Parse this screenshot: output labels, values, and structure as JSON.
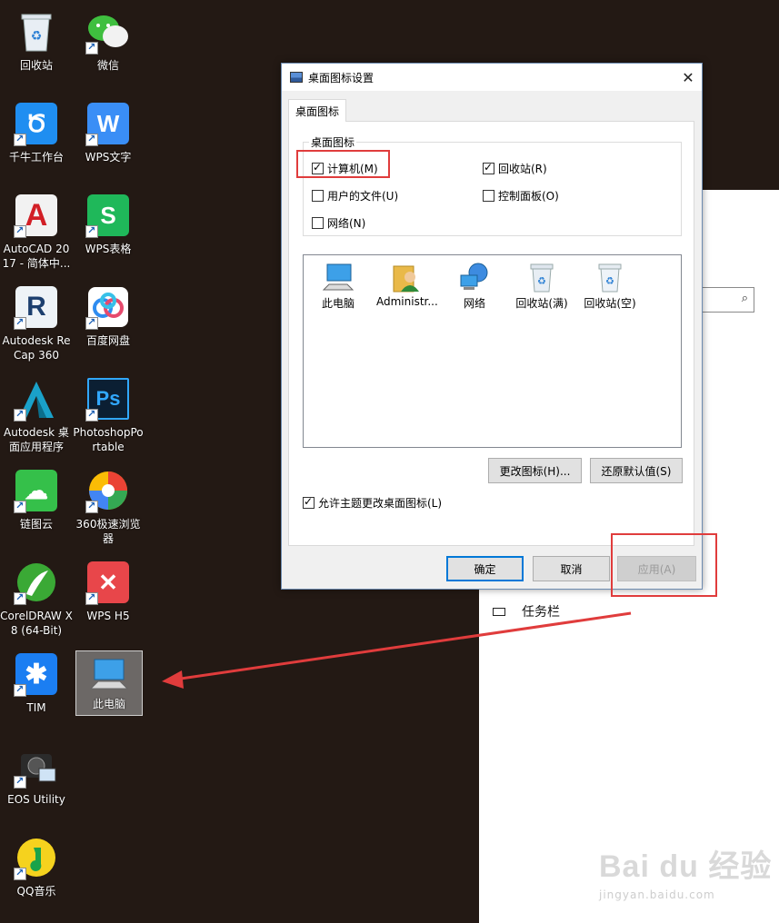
{
  "desktop": {
    "icons": [
      {
        "label": "回收站",
        "icon": "recycle-bin-icon"
      },
      {
        "label": "微信",
        "icon": "wechat-icon"
      },
      {
        "label": "千牛工作台",
        "icon": "qianniu-icon"
      },
      {
        "label": "WPS文字",
        "icon": "wps-writer-icon"
      },
      {
        "label": "AutoCAD 2017 - 简体中...",
        "icon": "autocad-icon"
      },
      {
        "label": "WPS表格",
        "icon": "wps-spreadsheet-icon"
      },
      {
        "label": "Autodesk ReCap 360",
        "icon": "recap-icon"
      },
      {
        "label": "百度网盘",
        "icon": "baidu-netdisk-icon"
      },
      {
        "label": "Autodesk 桌面应用程序",
        "icon": "autodesk-desktop-app-icon"
      },
      {
        "label": "PhotoshopPortable",
        "icon": "photoshop-icon"
      },
      {
        "label": "链图云",
        "icon": "liantuyun-icon"
      },
      {
        "label": "360极速浏览器",
        "icon": "360-browser-icon"
      },
      {
        "label": "CorelDRAW X8 (64-Bit)",
        "icon": "coreldraw-icon"
      },
      {
        "label": "WPS H5",
        "icon": "wps-h5-icon"
      },
      {
        "label": "TIM",
        "icon": "tim-icon"
      },
      {
        "label": "此电脑",
        "icon": "this-pc-icon"
      },
      {
        "label": "EOS Utility",
        "icon": "eos-utility-icon"
      },
      {
        "label": "QQ音乐",
        "icon": "qq-music-icon"
      }
    ],
    "tile_letters": {
      "wps_writer": "W",
      "wps_spreadsheet": "S",
      "photoshop": "Ps",
      "autocad": "A",
      "recap": "R"
    }
  },
  "dialog": {
    "title": "桌面图标设置",
    "close": "✕",
    "tab": "桌面图标",
    "group_label": "桌面图标",
    "checkboxes": [
      {
        "label": "计算机(M)",
        "checked": true
      },
      {
        "label": "回收站(R)",
        "checked": true
      },
      {
        "label": "用户的文件(U)",
        "checked": false
      },
      {
        "label": "控制面板(O)",
        "checked": false
      },
      {
        "label": "网络(N)",
        "checked": false
      }
    ],
    "icon_list": [
      {
        "label": "此电脑",
        "icon": "this-pc-icon"
      },
      {
        "label": "Administr...",
        "icon": "user-folder-icon"
      },
      {
        "label": "网络",
        "icon": "network-icon"
      },
      {
        "label": "回收站(满)",
        "icon": "recycle-bin-full-icon"
      },
      {
        "label": "回收站(空)",
        "icon": "recycle-bin-empty-icon"
      }
    ],
    "change_icon_button": "更改图标(H)...",
    "restore_default_button": "还原默认值(S)",
    "allow_themes_checkbox": {
      "label": "允许主题更改桌面图标(L)",
      "checked": true
    },
    "ok_button": "确定",
    "cancel_button": "取消",
    "apply_button": "应用(A)",
    "apply_enabled": false
  },
  "settings": {
    "taskbar_label": "任务栏"
  },
  "watermark": {
    "main": "Bai du 经验",
    "sub": "jingyan.baidu.com"
  },
  "colors": {
    "desktop_bg": "#231914",
    "annotation_red": "#e03c3c",
    "accent_blue": "#0078d7"
  }
}
